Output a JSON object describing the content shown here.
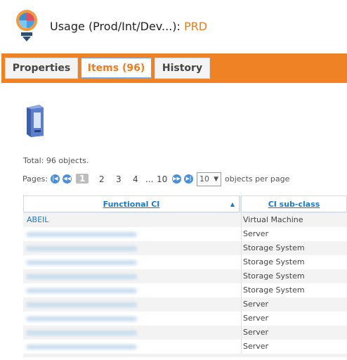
{
  "header": {
    "title_label": "Usage (Prod/Int/Dev...):",
    "title_value": "PRD"
  },
  "tabs": [
    {
      "label": "Properties"
    },
    {
      "label": "Items (96)"
    },
    {
      "label": "History"
    }
  ],
  "summary": {
    "total": "Total: 96 objects."
  },
  "pager": {
    "label": "Pages:",
    "pages": [
      "1",
      "2",
      "3",
      "4",
      "...",
      "10"
    ],
    "per_page_value": "10",
    "per_page_label": "objects per page"
  },
  "table": {
    "columns": [
      "Functional CI",
      "CI sub-class"
    ],
    "rows": [
      {
        "ci": "ABEIL",
        "subclass": "Virtual Machine"
      },
      {
        "ci": "",
        "subclass": "Server"
      },
      {
        "ci": "",
        "subclass": "Storage System"
      },
      {
        "ci": "",
        "subclass": "Storage System"
      },
      {
        "ci": "",
        "subclass": "Storage System"
      },
      {
        "ci": "",
        "subclass": "Storage System"
      },
      {
        "ci": "",
        "subclass": "Server"
      },
      {
        "ci": "",
        "subclass": "Server"
      },
      {
        "ci": "",
        "subclass": "Server"
      },
      {
        "ci": "",
        "subclass": "Server"
      }
    ]
  },
  "colors": {
    "accent": "#ee8224",
    "link": "#1b78c8",
    "title_value": "#f07c1a"
  },
  "icons": [
    "app-gauge-icon",
    "server-icon",
    "first-page-icon",
    "prev-page-icon",
    "next-page-icon",
    "last-page-icon",
    "sort-asc-icon",
    "dropdown-arrow-icon"
  ]
}
